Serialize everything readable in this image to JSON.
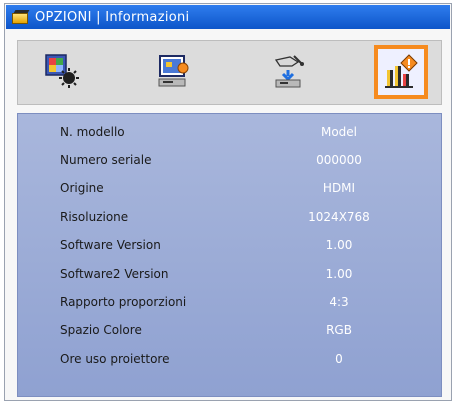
{
  "window": {
    "title": "OPZIONI | Informazioni"
  },
  "tabs": [
    {
      "name": "Immagine",
      "icon": "picture-settings-icon",
      "active": false
    },
    {
      "name": "Schermo",
      "icon": "screen-settings-icon",
      "active": false
    },
    {
      "name": "Impostazioni",
      "icon": "setup-icon",
      "active": false
    },
    {
      "name": "Opzioni",
      "icon": "options-info-icon",
      "active": true
    }
  ],
  "info": {
    "rows": [
      {
        "label": "N. modello",
        "value": "Model"
      },
      {
        "label": "Numero seriale",
        "value": "000000"
      },
      {
        "label": "Origine",
        "value": "HDMI"
      },
      {
        "label": "Risoluzione",
        "value": "1024X768"
      },
      {
        "label": "Software Version",
        "value": "1.00"
      },
      {
        "label": "Software2 Version",
        "value": "1.00"
      },
      {
        "label": "Rapporto proporzioni",
        "value": "4:3"
      },
      {
        "label": "Spazio Colore",
        "value": "RGB"
      },
      {
        "label": "Ore uso proiettore",
        "value": "0"
      }
    ]
  },
  "colors": {
    "title_bar": "#1565d8",
    "accent_highlight": "#f68b1f",
    "panel_background": "#9aabd6",
    "value_text": "#ffffff"
  }
}
